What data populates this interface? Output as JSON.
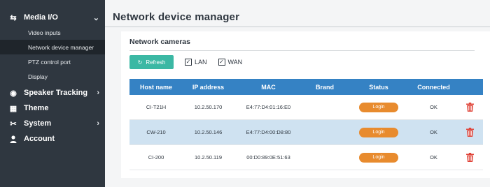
{
  "sidebar": {
    "media": {
      "label": "Media I/O",
      "items": [
        "Video inputs",
        "Network device manager",
        "PTZ control port",
        "Display"
      ]
    },
    "speaker_tracking": {
      "label": "Speaker Tracking"
    },
    "theme": {
      "label": "Theme"
    },
    "system": {
      "label": "System"
    },
    "account": {
      "label": "Account"
    }
  },
  "main": {
    "title": "Network device manager",
    "section_title": "Network cameras",
    "refresh_label": "Refresh",
    "lan_label": "LAN",
    "wan_label": "WAN",
    "lan_checked": true,
    "wan_checked": true,
    "columns": [
      "Host name",
      "IP address",
      "MAC",
      "Brand",
      "Status",
      "Connected"
    ],
    "rows": [
      {
        "host": "CI-T21H",
        "ip": "10.2.50.170",
        "mac": "E4:77:D4:01:16:E0",
        "brand": "",
        "status": "Login",
        "connected": "OK"
      },
      {
        "host": "CW-210",
        "ip": "10.2.50.146",
        "mac": "E4:77:D4:00:D8:80",
        "brand": "",
        "status": "Login",
        "connected": "OK"
      },
      {
        "host": "CI-200",
        "ip": "10.2.50.119",
        "mac": "00:D0:89:0E:51:63",
        "brand": "",
        "status": "Login",
        "connected": "OK"
      }
    ]
  },
  "colors": {
    "sidebar_bg": "#2f3740",
    "accent_teal": "#3bb8a4",
    "header_blue": "#3582c4",
    "selected_row": "#cfe2f1",
    "login_orange": "#e88b2e",
    "delete_red": "#e0453a"
  }
}
